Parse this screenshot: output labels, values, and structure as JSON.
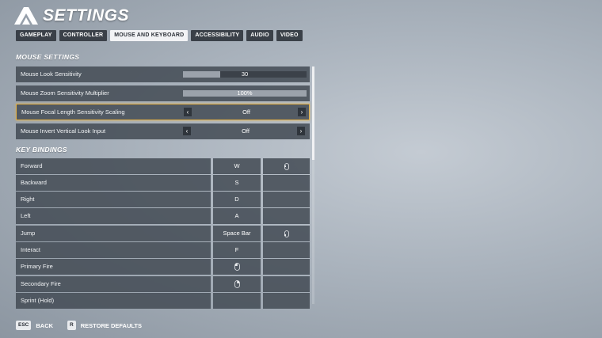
{
  "header": {
    "title": "SETTINGS"
  },
  "tabs": [
    {
      "label": "GAMEPLAY"
    },
    {
      "label": "CONTROLLER"
    },
    {
      "label": "MOUSE AND KEYBOARD",
      "active": true
    },
    {
      "label": "ACCESSIBILITY"
    },
    {
      "label": "AUDIO"
    },
    {
      "label": "VIDEO"
    }
  ],
  "mouse_settings": {
    "heading": "MOUSE SETTINGS",
    "rows": [
      {
        "label": "Mouse Look Sensitivity",
        "value": "30",
        "fill": 0.3
      },
      {
        "label": "Mouse Zoom Sensitivity Multiplier",
        "value": "100%",
        "fill": 1.0
      },
      {
        "label": "Mouse Focal Length Sensitivity Scaling",
        "value": "Off"
      },
      {
        "label": "Mouse Invert Vertical Look Input",
        "value": "Off"
      }
    ]
  },
  "key_bindings": {
    "heading": "KEY BINDINGS",
    "rows": [
      {
        "action": "Forward",
        "primary": "W",
        "secondary_icon": "mouse-side-button-icon"
      },
      {
        "action": "Backward",
        "primary": "S",
        "secondary": ""
      },
      {
        "action": "Right",
        "primary": "D",
        "secondary": ""
      },
      {
        "action": "Left",
        "primary": "A",
        "secondary": ""
      },
      {
        "action": "Jump",
        "primary": "Space Bar",
        "secondary_icon": "mouse-side-button-icon"
      },
      {
        "action": "Interact",
        "primary": "F",
        "secondary": ""
      },
      {
        "action": "Primary Fire",
        "primary_icon": "mouse-left-click-icon",
        "secondary": ""
      },
      {
        "action": "Secondary Fire",
        "primary_icon": "mouse-right-click-icon",
        "secondary": ""
      },
      {
        "action": "Sprint (Hold)",
        "primary": "",
        "secondary": ""
      }
    ]
  },
  "footer": {
    "back_key": "ESC",
    "back_label": "BACK",
    "restore_key": "R",
    "restore_label": "RESTORE DEFAULTS"
  },
  "colors": {
    "focus_outline": "#e1b04a",
    "row_bg": "#464d56",
    "active_tab_bg": "#f2f3f5"
  }
}
